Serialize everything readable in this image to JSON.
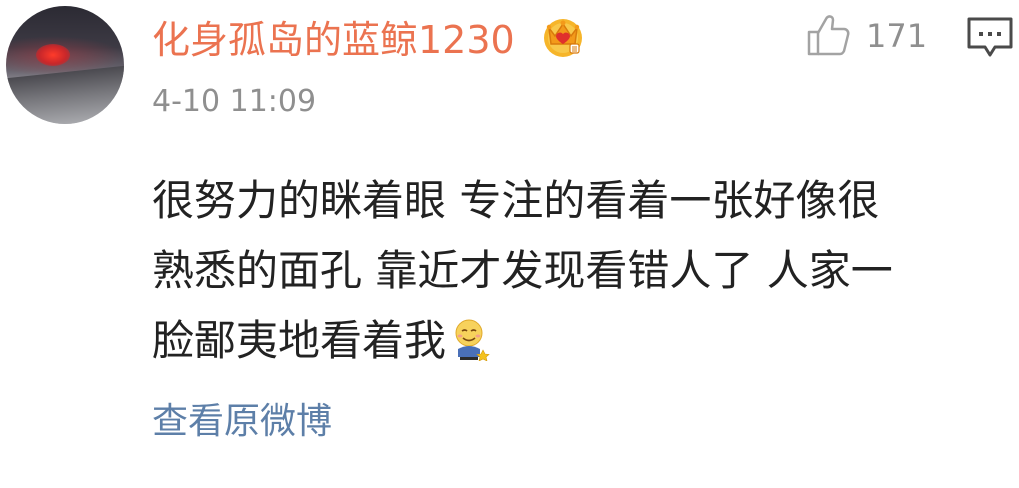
{
  "comment": {
    "username": "化身孤岛的蓝鲸1230",
    "timestamp": "4-10 11:09",
    "like_count": "171",
    "body_lines": [
      "很努力的眯着眼 专注的看着一张好像很",
      "熟悉的面孔 靠近才发现看错人了 人家一",
      "脸鄙夷地看着我"
    ],
    "view_original_label": "查看原微博",
    "colors": {
      "username": "#eb7350",
      "meta": "#8f8f8f",
      "body": "#222222",
      "link": "#5d7fa8"
    },
    "icons": {
      "badge": "vip-crown-icon",
      "like": "thumbs-up-icon",
      "reply": "reply-comment-icon",
      "emoji": "sweat-smile-emoji-icon"
    }
  }
}
